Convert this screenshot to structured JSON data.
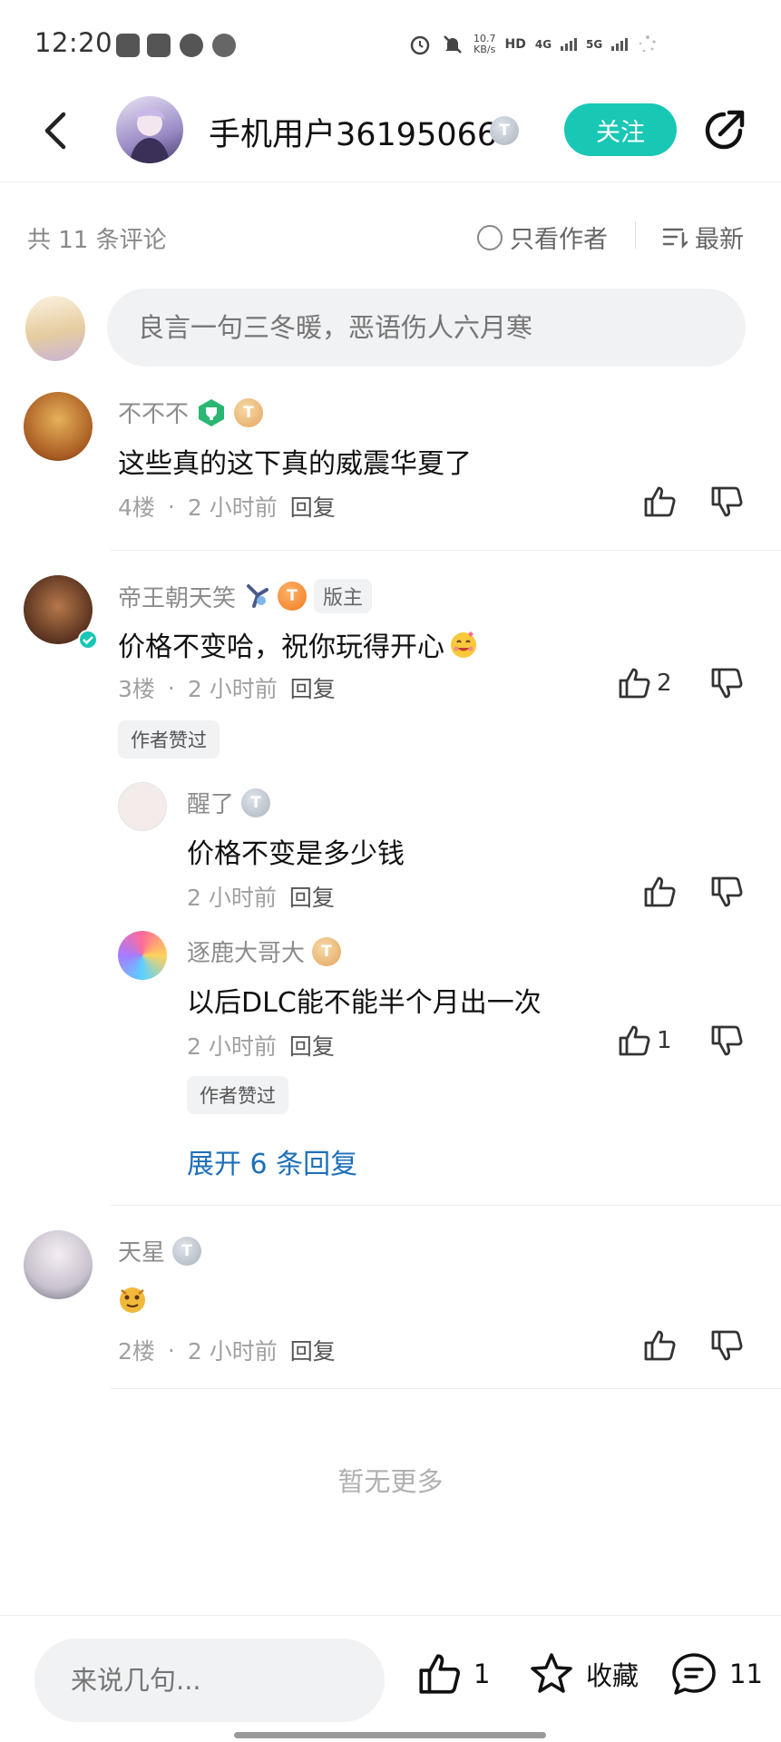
{
  "status_bar": {
    "time": "12:20",
    "app_icons": [
      "tieba-icon",
      "telegram-icon",
      "weibo-icon",
      "settings-app-icon"
    ],
    "speed_value": "10.7",
    "speed_unit": "KB/s",
    "hd_label": "HD",
    "net1": "4G",
    "net2": "5G"
  },
  "header": {
    "user_name": "手机用户36195066",
    "level_badge": "T",
    "follow_label": "关注"
  },
  "filters": {
    "comment_count": "共 11 条评论",
    "only_author": "只看作者",
    "sort": "最新"
  },
  "comment_box": {
    "placeholder": "良言一句三冬暖，恶语伤人六月寒"
  },
  "comments": [
    {
      "user": "不不不",
      "badge": "T",
      "text": "这些真的这下真的威震华夏了",
      "floor": "4楼",
      "time": "2 小时前",
      "reply": "回复"
    },
    {
      "user": "帝王朝天笑",
      "badge": "T",
      "role": "版主",
      "text": "价格不变哈，祝你玩得开心",
      "floor": "3楼",
      "time": "2 小时前",
      "reply": "回复",
      "likes": "2",
      "liked_by_author": "作者赞过",
      "replies": [
        {
          "user": "醒了",
          "badge": "T",
          "text": "价格不变是多少钱",
          "time": "2 小时前",
          "reply": "回复"
        },
        {
          "user": "逐鹿大哥大",
          "badge": "T",
          "text": "以后DLC能不能半个月出一次",
          "time": "2 小时前",
          "reply": "回复",
          "likes": "1",
          "liked_by_author": "作者赞过"
        }
      ],
      "expand_label": "展开 6 条回复"
    },
    {
      "user": "天星",
      "badge": "T",
      "text": "",
      "floor": "2楼",
      "time": "2 小时前",
      "reply": "回复"
    }
  ],
  "dot": "·",
  "no_more": "暂无更多",
  "bottom_bar": {
    "input_placeholder": "来说几句...",
    "like_count": "1",
    "favorite_label": "收藏",
    "comment_count": "11"
  },
  "colors": {
    "accent": "#19c7b5",
    "link": "#1e6fb8",
    "muted": "#a0a0a0"
  }
}
